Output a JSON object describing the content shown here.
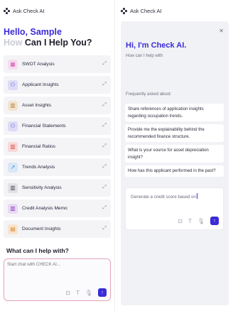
{
  "brand_name": "Ask Check AI",
  "left": {
    "greeting": "Hello, Sample",
    "subtitle_muted": "How",
    "subtitle_main": "Can I Help You?",
    "menu": [
      {
        "label": "SWOT Analysis",
        "icon": "grid-icon",
        "color": "#d45fb0",
        "bg": "#f7dcef"
      },
      {
        "label": "Applicant Insights",
        "icon": "person-icon",
        "color": "#5b5bd6",
        "bg": "#dcdcf8"
      },
      {
        "label": "Asset Insights",
        "icon": "bar-chart-icon",
        "color": "#b6864a",
        "bg": "#f3e4cf"
      },
      {
        "label": "Financial Statements",
        "icon": "person-doc-icon",
        "color": "#5b5bd6",
        "bg": "#dcdcf8"
      },
      {
        "label": "Financial Ratios",
        "icon": "ratio-chart-icon",
        "color": "#d9534f",
        "bg": "#f8d9d8"
      },
      {
        "label": "Trends Analysis",
        "icon": "trend-icon",
        "color": "#3a8fd6",
        "bg": "#d8e8f8"
      },
      {
        "label": "Sensitivity Analysis",
        "icon": "sensitivity-chart-icon",
        "color": "#4a4a55",
        "bg": "#e2e2e6"
      },
      {
        "label": "Credit Analysis Memo",
        "icon": "memo-chart-icon",
        "color": "#8b3fb8",
        "bg": "#ead8f4"
      },
      {
        "label": "Document Insights",
        "icon": "document-icon",
        "color": "#d88a35",
        "bg": "#f8e4cd"
      }
    ],
    "arrow_glyph": "⤢",
    "ask_title": "What can I help with?",
    "chat_placeholder": "Start chat with CHECK AI..."
  },
  "right": {
    "close_glyph": "✕",
    "title": "Hi, I'm Check AI.",
    "subtitle": "How can I help with",
    "faq_title": "Frequently asked about:",
    "faqs": [
      "Share references of application insights regarding occupation trends.",
      "Provide me the explainability behind the recommended finance structure.",
      "What is your source for asset depreciation insight?",
      "How has this applicant performed in the past?"
    ],
    "chat_value": "Generate a credit score based on"
  },
  "tools": {
    "attach": "⊡",
    "text": "T",
    "mic": "🎙",
    "send": "↑"
  },
  "colors": {
    "accent": "#3b2bd6",
    "chat_border": "#e4a3b8"
  }
}
